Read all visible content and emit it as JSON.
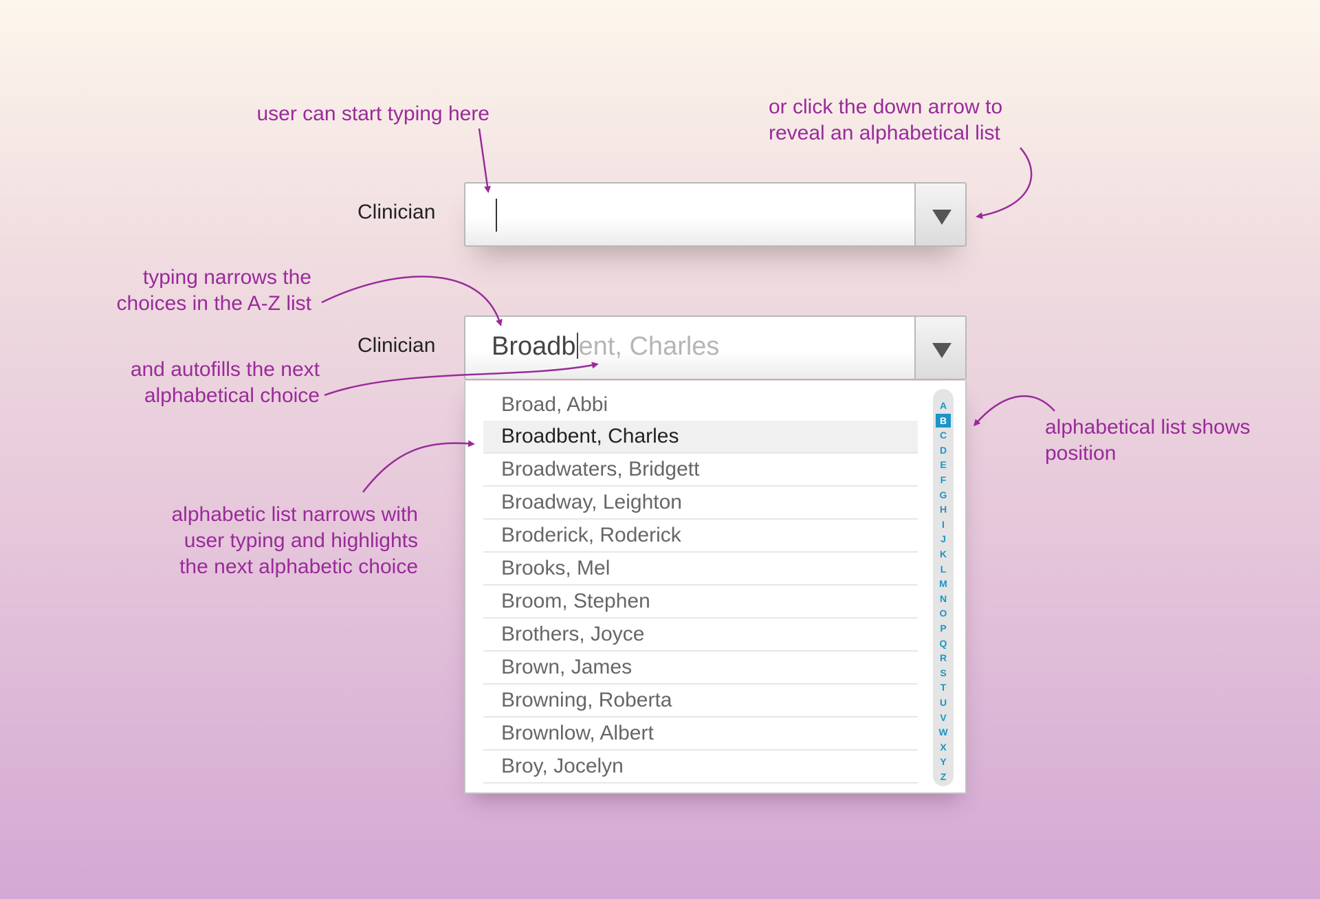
{
  "annotations": {
    "typing_here": "user can start typing here",
    "down_arrow": [
      "or click the down arrow to",
      "reveal an alphabetical list"
    ],
    "typing_narrows": [
      "typing narrows the",
      "choices in the A-Z list"
    ],
    "autofills": [
      "and autofills the next",
      "alphabetical choice"
    ],
    "list_narrows": [
      "alphabetic list narrows with",
      "user typing and highlights",
      "the next alphabetic choice"
    ],
    "shows_position": [
      "alphabetical list shows",
      "position"
    ]
  },
  "field1": {
    "label": "Clinician"
  },
  "field2": {
    "label": "Clinician",
    "typed": "Broadb",
    "autofill": "ent, Charles"
  },
  "list": {
    "items": [
      "Broad, Abbi",
      "Broadbent, Charles",
      "Broadwaters, Bridgett",
      "Broadway, Leighton",
      "Broderick, Roderick",
      "Brooks, Mel",
      "Broom, Stephen",
      "Brothers, Joyce",
      "Brown, James",
      "Browning, Roberta",
      "Brownlow, Albert",
      "Broy, Jocelyn"
    ],
    "highlighted": "Broadbent, Charles"
  },
  "az_index": {
    "letters": [
      "A",
      "B",
      "C",
      "D",
      "E",
      "F",
      "G",
      "H",
      "I",
      "J",
      "K",
      "L",
      "M",
      "N",
      "O",
      "P",
      "Q",
      "R",
      "S",
      "T",
      "U",
      "V",
      "W",
      "X",
      "Y",
      "Z"
    ],
    "selected": "B"
  },
  "colors": {
    "annotation": "#9a2a9a",
    "az_letter": "#1b95c8"
  },
  "icons": {
    "dropdown_arrow": "triangle-down-icon",
    "annotation_arrow": "curved-arrow-icon"
  }
}
